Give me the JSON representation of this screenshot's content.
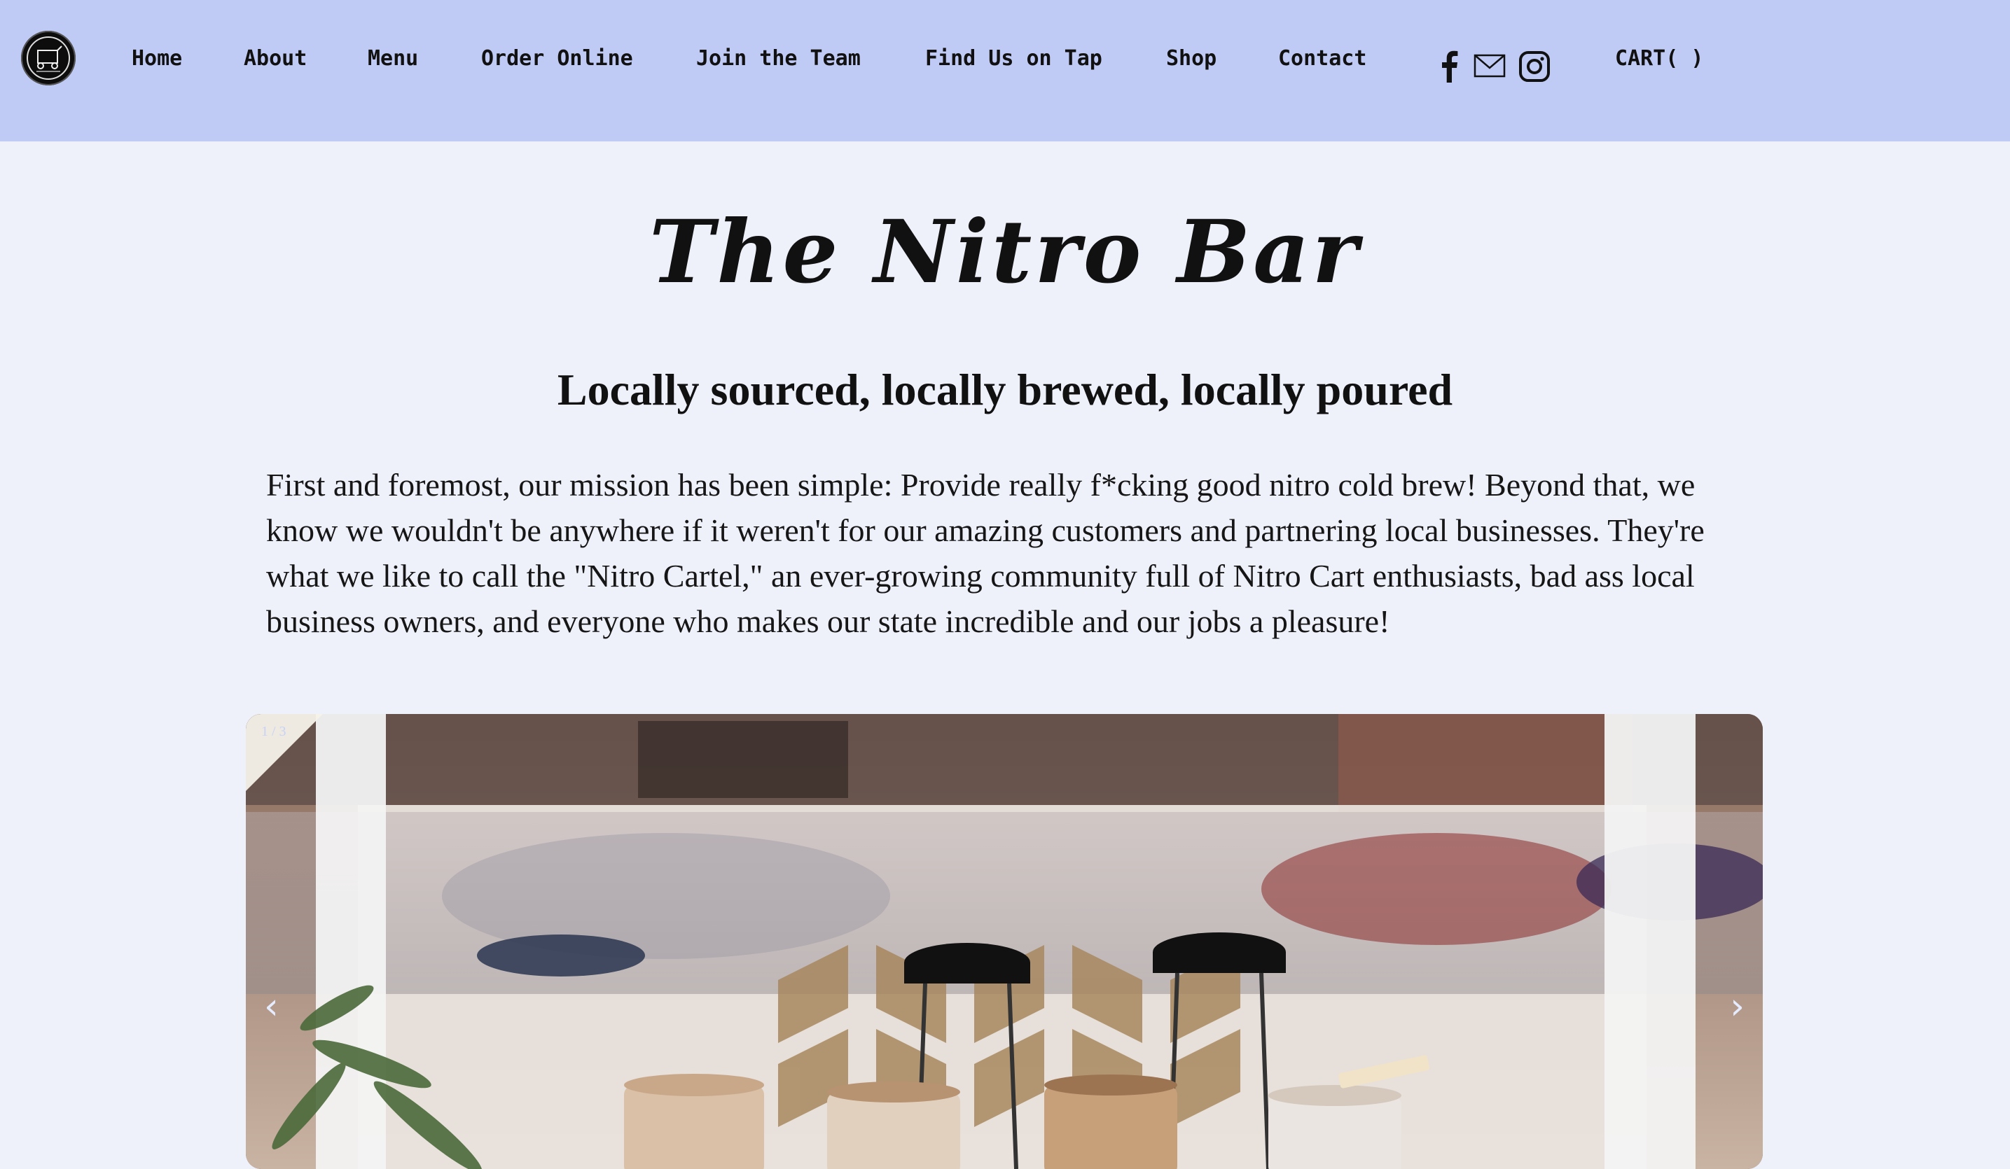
{
  "nav": {
    "items": [
      {
        "label": "Home"
      },
      {
        "label": "About"
      },
      {
        "label": "Menu"
      },
      {
        "label": "Order Online"
      },
      {
        "label": "Join the Team"
      },
      {
        "label": "Find Us on Tap"
      },
      {
        "label": "Shop"
      },
      {
        "label": "Contact"
      }
    ],
    "cart_label": "CART( )",
    "social": [
      "facebook-icon",
      "mail-icon",
      "instagram-icon"
    ],
    "background": "#bfcbf5"
  },
  "main": {
    "title": "The Nitro Bar",
    "subtitle": "Locally sourced, locally brewed, locally poured",
    "mission": "First and foremost, our mission has been simple: Provide really f*cking good nitro cold brew! Beyond that, we know we wouldn't be anywhere if it weren't for our amazing customers and partnering local businesses. They're what we like to call the \"Nitro Cartel,\" an ever-growing community full of Nitro Cart enthusiasts, bad ass local business owners, and everyone who makes our state incredible and our jobs a pleasure!"
  },
  "slideshow": {
    "counter": "1 / 3",
    "prev_arrow": "‹",
    "next_arrow": "›"
  }
}
